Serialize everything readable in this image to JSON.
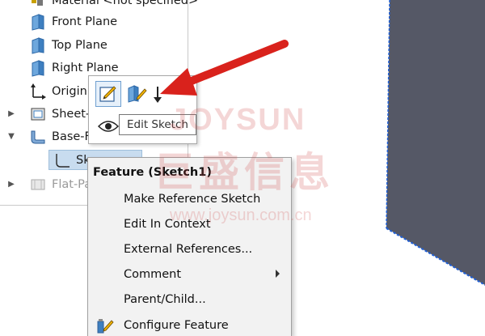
{
  "tree": {
    "material": {
      "label": "Material <not specified>",
      "icon": "material-icon"
    },
    "front_plane": {
      "label": "Front Plane",
      "icon": "plane-icon"
    },
    "top_plane": {
      "label": "Top Plane",
      "icon": "plane-icon"
    },
    "right_plane": {
      "label": "Right Plane",
      "icon": "plane-icon"
    },
    "origin": {
      "label": "Origin",
      "icon": "origin-icon"
    },
    "sheet_metal": {
      "label": "Sheet-",
      "icon": "sheet-metal-icon"
    },
    "base_flange": {
      "label": "Base-F",
      "icon": "base-flange-icon"
    },
    "sketch1": {
      "label": "Sk",
      "icon": "sketch-icon"
    },
    "flat_pattern": {
      "label": "Flat-Pa",
      "icon": "flat-pattern-icon"
    }
  },
  "context_toolbar": {
    "buttons": [
      {
        "name": "edit-sketch",
        "icon": "edit-sketch-icon"
      },
      {
        "name": "edit-feature",
        "icon": "edit-feature-icon"
      },
      {
        "name": "rollback",
        "icon": "rollback-icon"
      },
      {
        "name": "hide",
        "icon": "eye-icon"
      }
    ],
    "tooltip": "Edit Sketch"
  },
  "context_menu": {
    "header": "Feature (Sketch1)",
    "items": [
      {
        "label": "Make Reference Sketch",
        "has_submenu": false
      },
      {
        "label": "Edit In Context",
        "has_submenu": false
      },
      {
        "label": "External References...",
        "has_submenu": false
      },
      {
        "label": "Comment",
        "has_submenu": true
      },
      {
        "label": "Parent/Child...",
        "has_submenu": false
      },
      {
        "label": "Configure Feature",
        "has_submenu": false,
        "icon": "configure-feature-icon"
      }
    ]
  },
  "watermark": {
    "brand": "JOYSUN",
    "chinese": "巨盛信息",
    "url": "www.joysun.com.cn"
  },
  "colors": {
    "annotation_arrow": "#d9221c",
    "part_face": "#555866",
    "part_edge": "#1f5fd6",
    "selection": "#c8dcef",
    "watermark": "#d04a4a"
  }
}
